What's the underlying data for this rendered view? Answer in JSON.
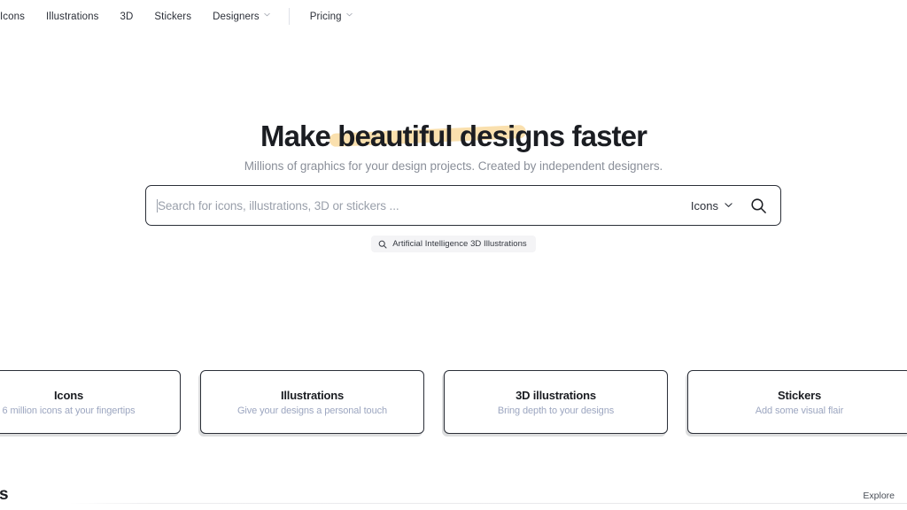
{
  "nav": {
    "items": [
      {
        "label": "Icons",
        "has_chevron": false,
        "icon": null
      },
      {
        "label": "Illustrations",
        "has_chevron": false,
        "icon": null
      },
      {
        "label": "3D",
        "has_chevron": false,
        "icon": null
      },
      {
        "label": "Stickers",
        "has_chevron": false,
        "icon": null
      },
      {
        "label": "Designers",
        "has_chevron": true,
        "icon": "chevron-down-icon"
      },
      {
        "label": "Pricing",
        "has_chevron": true,
        "icon": "chevron-down-icon"
      }
    ]
  },
  "hero": {
    "headline_full": "Make beautiful designs faster",
    "headline_part1": "Make ",
    "headline_highlight": "beautiful designs",
    "headline_part2": " faster",
    "highlight_color": "#FAE0AE",
    "subtitle": "Millions of graphics for your design projects. Created by independent designers."
  },
  "search": {
    "placeholder": "Search for icons, illustrations, 3D or stickers ...",
    "value": "",
    "type_selected": "Icons",
    "type_chevron_icon": "chevron-down-icon",
    "submit_icon": "search-icon",
    "suggestion": {
      "icon": "search-icon",
      "label": "Artificial Intelligence 3D Illustrations"
    }
  },
  "cards": [
    {
      "title": "Icons",
      "subtitle": "6 million icons at your fingertips"
    },
    {
      "title": "Illustrations",
      "subtitle": "Give your designs a personal touch"
    },
    {
      "title": "3D illustrations",
      "subtitle": "Bring depth to your designs"
    },
    {
      "title": "Stickers",
      "subtitle": "Add some visual flair"
    }
  ],
  "bottom_section": {
    "title": "Icons",
    "explore_label": "Explore"
  },
  "colors": {
    "text_primary": "#1B1D22",
    "text_muted": "#8A8F99",
    "card_subtitle": "#9CA6C0",
    "border": "#2B2F38",
    "highlight": "#FAE0AE",
    "pill_bg": "#F4F4F6"
  }
}
